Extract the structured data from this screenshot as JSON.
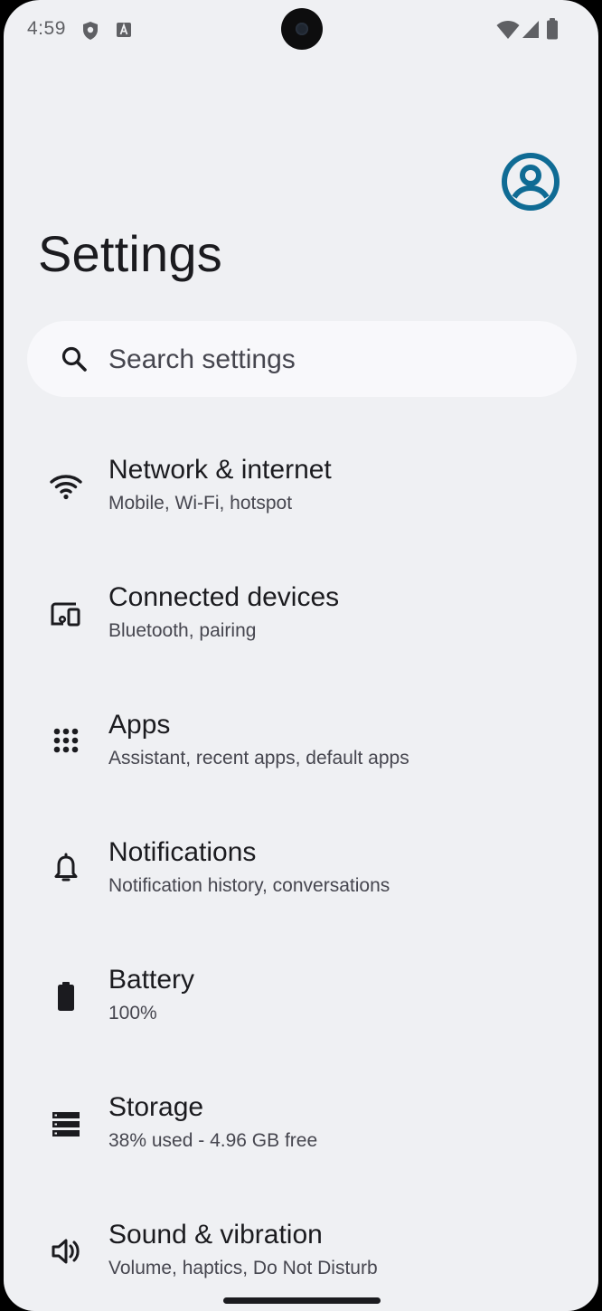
{
  "status_bar": {
    "time": "4:59",
    "icons": [
      "shield-icon",
      "keyboard-a-icon",
      "wifi-icon",
      "cell-signal-icon",
      "battery-icon"
    ]
  },
  "header": {
    "title": "Settings",
    "avatar_icon": "account-circle-icon"
  },
  "search": {
    "placeholder": "Search settings",
    "icon": "search-icon"
  },
  "colors": {
    "background": "#eff0f3",
    "search_background": "#f8f8fb",
    "avatar_accent": "#0f6b94",
    "text_primary": "#1b1b1f",
    "text_secondary": "#46464f"
  },
  "items": [
    {
      "title": "Network & internet",
      "subtitle": "Mobile, Wi-Fi, hotspot",
      "icon": "wifi-icon"
    },
    {
      "title": "Connected devices",
      "subtitle": "Bluetooth, pairing",
      "icon": "devices-icon"
    },
    {
      "title": "Apps",
      "subtitle": "Assistant, recent apps, default apps",
      "icon": "apps-grid-icon"
    },
    {
      "title": "Notifications",
      "subtitle": "Notification history, conversations",
      "icon": "bell-icon"
    },
    {
      "title": "Battery",
      "subtitle": "100%",
      "icon": "battery-icon"
    },
    {
      "title": "Storage",
      "subtitle": "38% used - 4.96 GB free",
      "icon": "storage-icon"
    },
    {
      "title": "Sound & vibration",
      "subtitle": "Volume, haptics, Do Not Disturb",
      "icon": "speaker-icon"
    }
  ]
}
